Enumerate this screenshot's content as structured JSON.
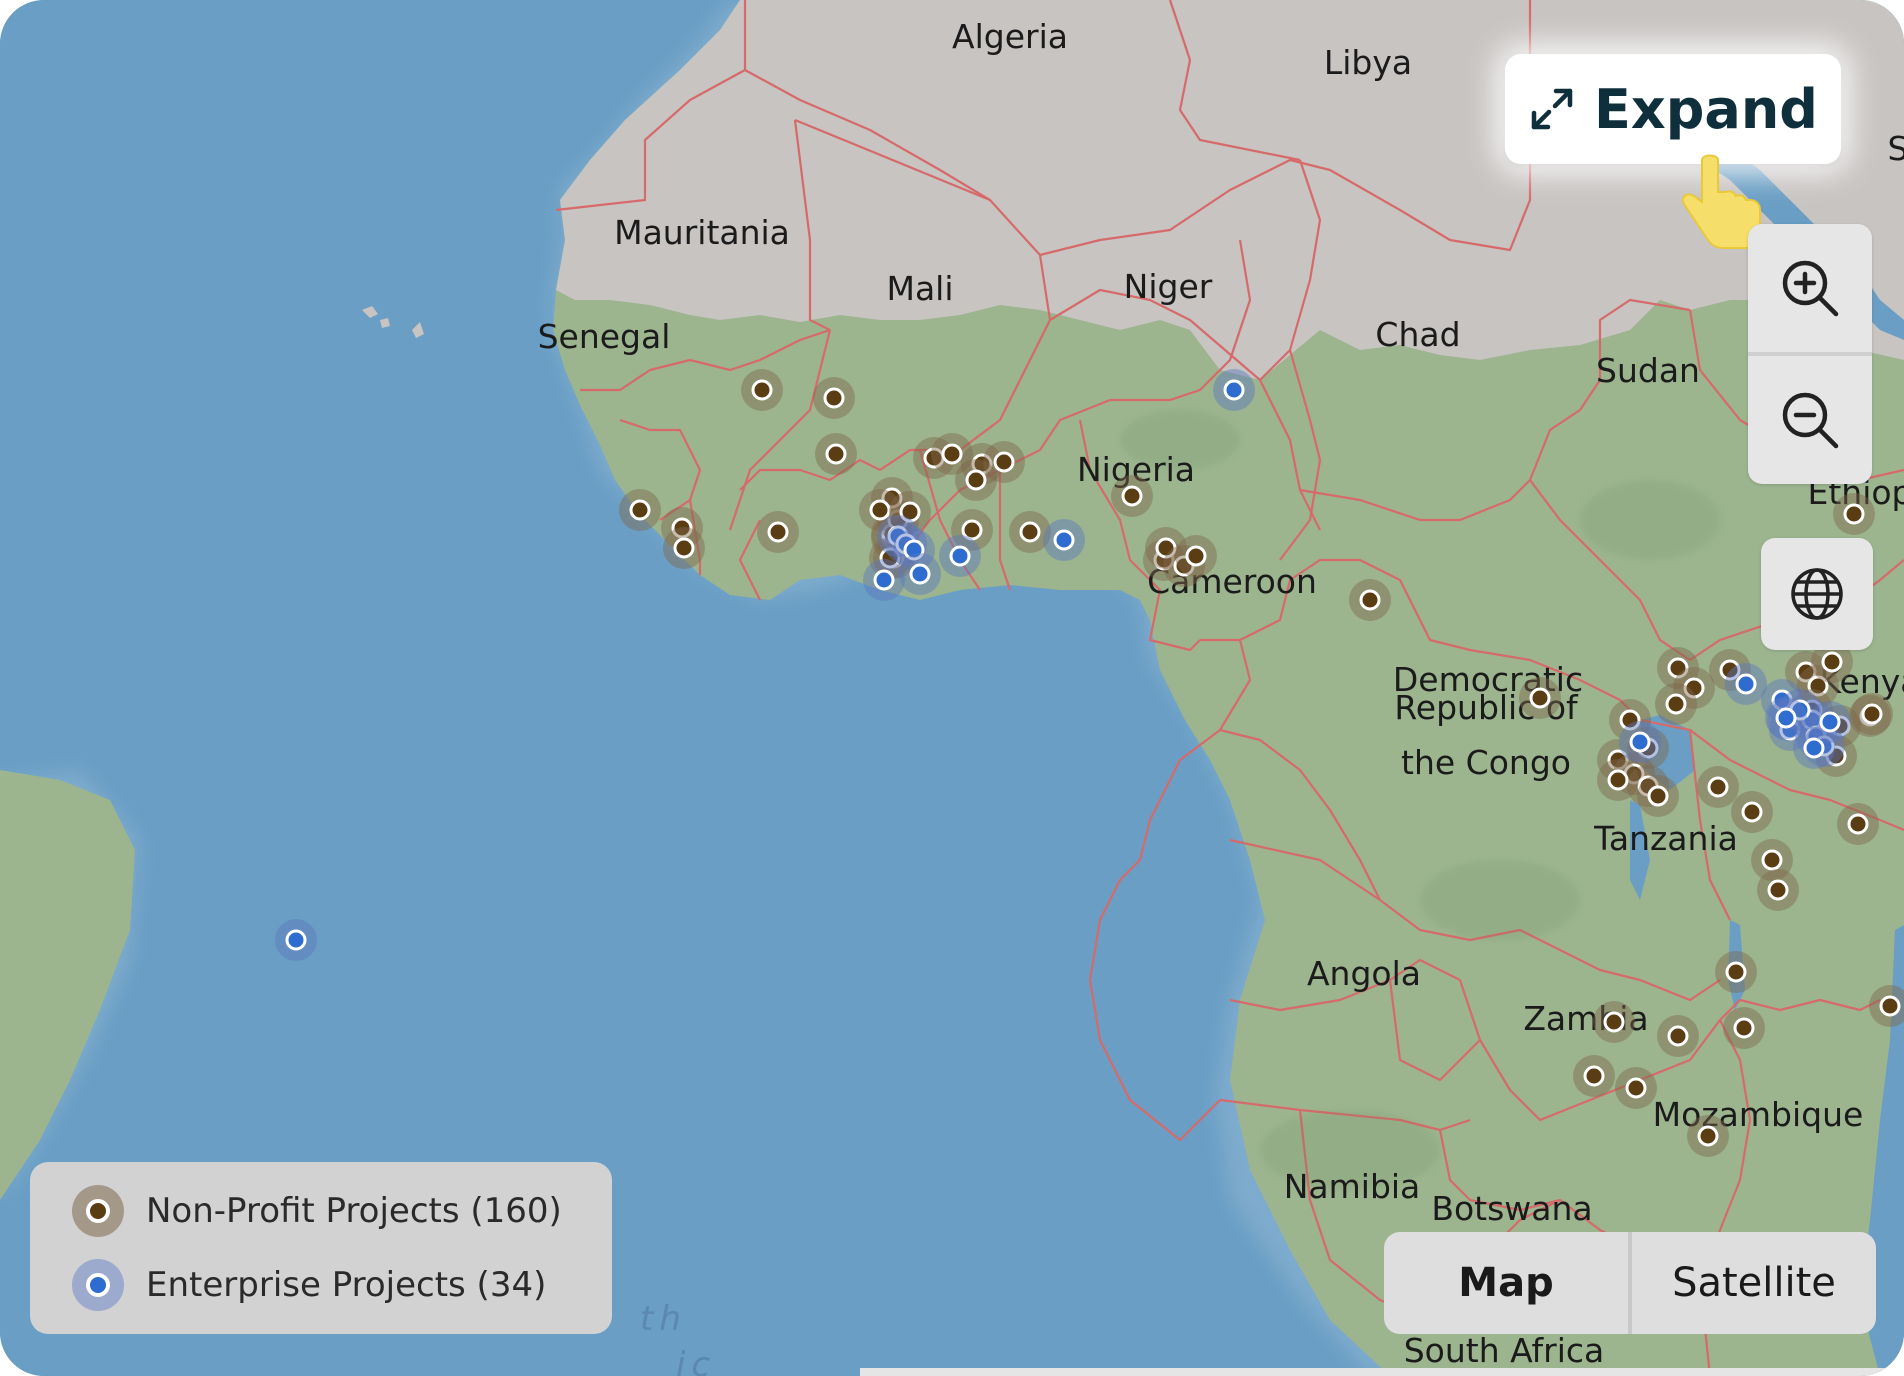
{
  "map": {
    "countries": [
      "Algeria",
      "Libya",
      "Mauritania",
      "Mali",
      "Niger",
      "Senegal",
      "Chad",
      "Sudan",
      "Nigeria",
      "Ethiop",
      "Cameroon",
      "Democratic",
      "Republic of",
      "the Congo",
      "Kenya",
      "Tanzania",
      "Angola",
      "Zambia",
      "Mozambique",
      "Namibia",
      "Botswana",
      "South Africa",
      "S"
    ],
    "ocean_fragments": [
      "th",
      "ic"
    ],
    "colors": {
      "water": "#6a9ec4",
      "land_desert": "#c8c4c2",
      "land_green": "#9cb58f",
      "border": "#d66a6a",
      "nonprofit": "#5a3d13",
      "enterprise": "#2f6ccf"
    }
  },
  "controls": {
    "expand_label": "Expand",
    "expand_icon": "expand-arrows-icon",
    "zoom_in_icon": "zoom-in-icon",
    "zoom_out_icon": "zoom-out-icon",
    "globe_icon": "globe-icon"
  },
  "legend": {
    "nonprofit": "Non-Profit Projects (160)",
    "enterprise": "Enterprise Projects (34)"
  },
  "map_type": {
    "map": "Map",
    "satellite": "Satellite",
    "selected": "Map"
  }
}
